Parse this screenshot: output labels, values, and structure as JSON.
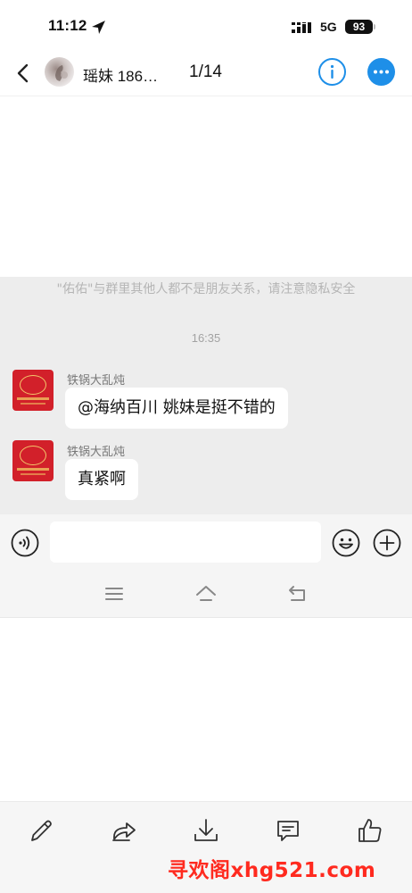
{
  "status_bar": {
    "time": "11:12",
    "network": "5G",
    "battery": "93"
  },
  "nav": {
    "title": "瑶妹 186…",
    "counter": "1/14"
  },
  "chat": {
    "privacy_notice": "\"佑佑\"与群里其他人都不是朋友关系，请注意隐私安全",
    "timestamp": "16:35",
    "messages": [
      {
        "sender": "铁锅大乱炖",
        "text": "@海纳百川  姚妹是挺不错的"
      },
      {
        "sender": "铁锅大乱炖",
        "text": "真紧啊"
      }
    ]
  },
  "input": {
    "placeholder": "",
    "value": ""
  },
  "icons": {
    "back": "back-chevron-icon",
    "info": "info-icon",
    "more": "more-icon",
    "voice": "voice-icon",
    "emoji": "emoji-icon",
    "plus": "plus-icon",
    "menu": "menu-icon",
    "home": "home-icon",
    "return": "return-icon",
    "edit": "pencil-icon",
    "share": "share-icon",
    "download": "download-icon",
    "comment": "comment-icon",
    "like": "thumbs-up-icon"
  },
  "colors": {
    "accent": "#1e8fe8",
    "chat_bg": "#ededed",
    "watermark": "#ff2a1f"
  },
  "watermark": "寻欢阁xhg521.com"
}
